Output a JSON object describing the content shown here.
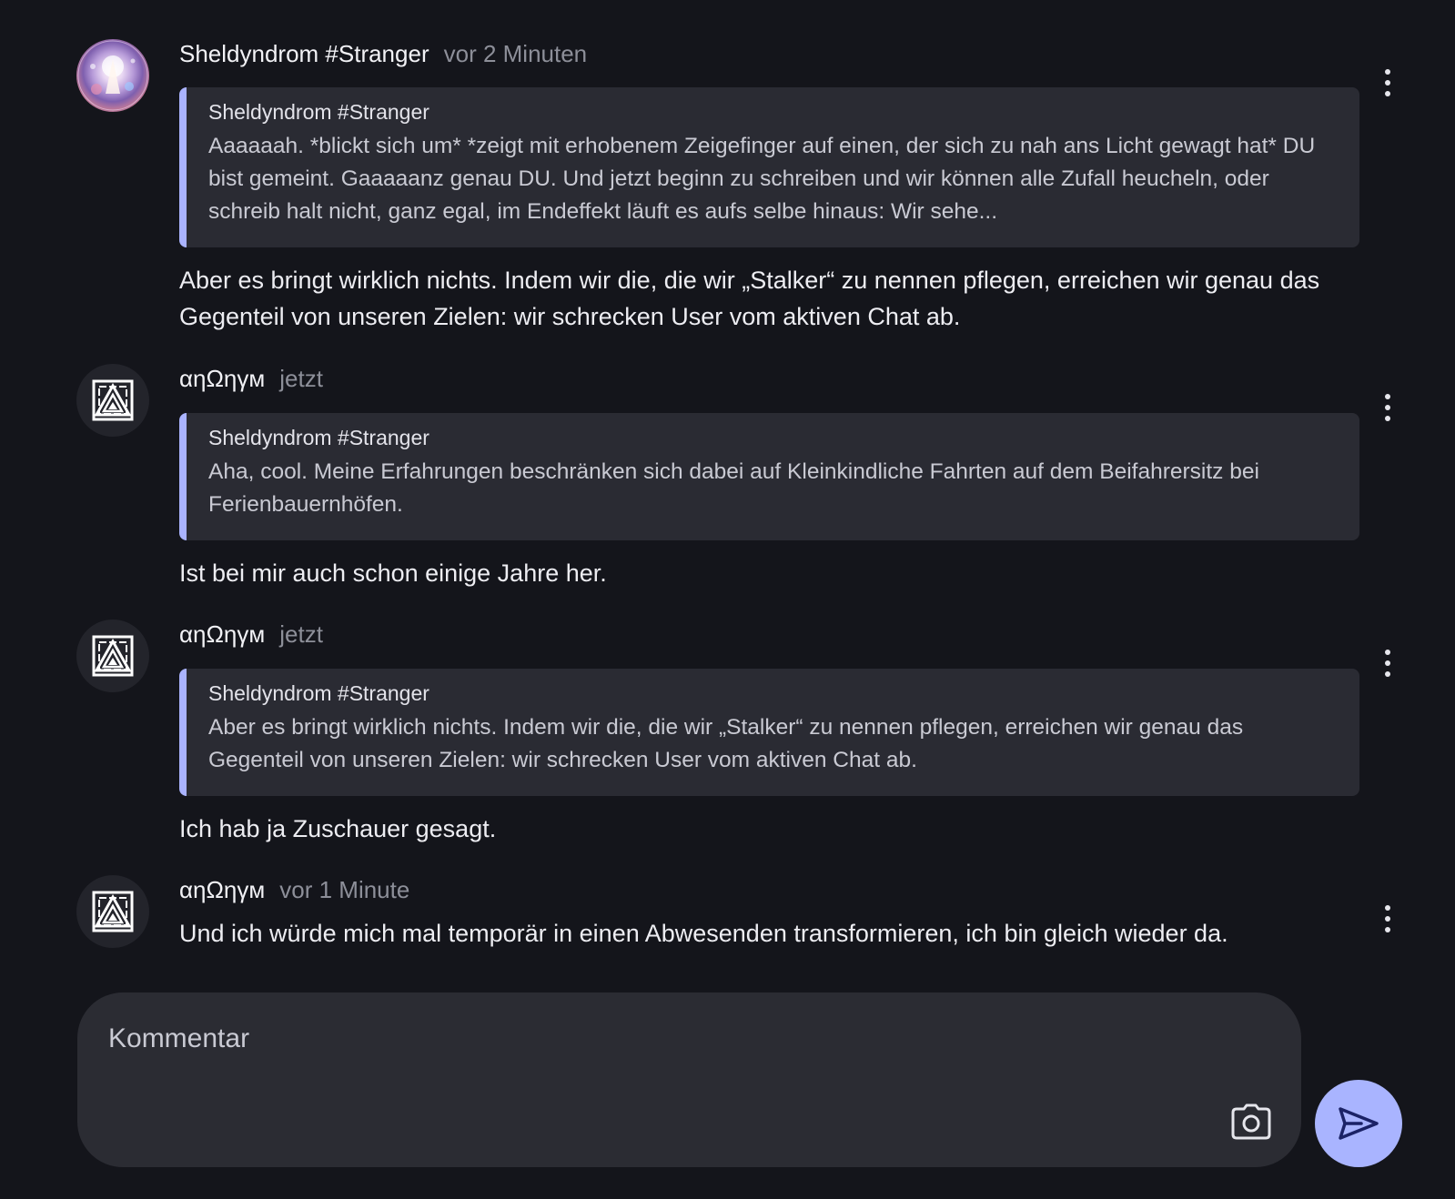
{
  "comments": [
    {
      "author": "Sheldyndrom #Stranger",
      "time": "vor 2 Minuten",
      "avatar_icon": "cosmic-figure-avatar",
      "quote": {
        "author": "Sheldyndrom #Stranger",
        "text": "Aaaaaah. *blickt sich um* *zeigt mit erhobenem Zeigefinger auf einen, der sich zu nah ans Licht gewagt hat* DU bist gemeint. Gaaaaanz genau DU. Und jetzt beginn zu schreiben und wir können alle Zufall heucheln, oder schreib halt nicht, ganz egal, im Endeffekt läuft es aufs selbe hinaus: Wir sehe..."
      },
      "text": "Aber es bringt wirklich nichts. Indem wir die, die wir „Stalker“ zu nennen pflegen, erreichen wir genau das Gegenteil von unseren Zielen: wir schrecken User vom aktiven Chat ab."
    },
    {
      "author": "αηΩηγм",
      "time": "jetzt",
      "avatar_icon": "maze-triangle-avatar",
      "quote": {
        "author": "Sheldyndrom #Stranger",
        "text": "Aha, cool. Meine Erfahrungen beschränken sich dabei auf Kleinkindliche Fahrten auf dem Beifahrersitz bei Ferienbauernhöfen."
      },
      "text": "Ist bei mir auch schon einige Jahre her."
    },
    {
      "author": "αηΩηγм",
      "time": "jetzt",
      "avatar_icon": "maze-triangle-avatar",
      "quote": {
        "author": "Sheldyndrom #Stranger",
        "text": "Aber es bringt wirklich nichts. Indem wir die, die wir „Stalker“ zu nennen pflegen, erreichen wir genau das Gegenteil von unseren Zielen: wir schrecken User vom aktiven Chat ab."
      },
      "text": "Ich hab ja Zuschauer gesagt."
    },
    {
      "author": "αηΩηγм",
      "time": "vor 1 Minute",
      "avatar_icon": "maze-triangle-avatar",
      "text": "Und ich würde mich mal temporär in einen Abwesenden transformieren, ich bin gleich wieder da."
    }
  ],
  "composer": {
    "placeholder": "Kommentar",
    "camera_icon": "camera-icon",
    "send_icon": "send-icon"
  },
  "colors": {
    "background": "#14151b",
    "quote_background": "#2a2b33",
    "quote_accent": "#aab3ff",
    "send_button": "#a9b4ff",
    "send_icon": "#1b2266"
  }
}
